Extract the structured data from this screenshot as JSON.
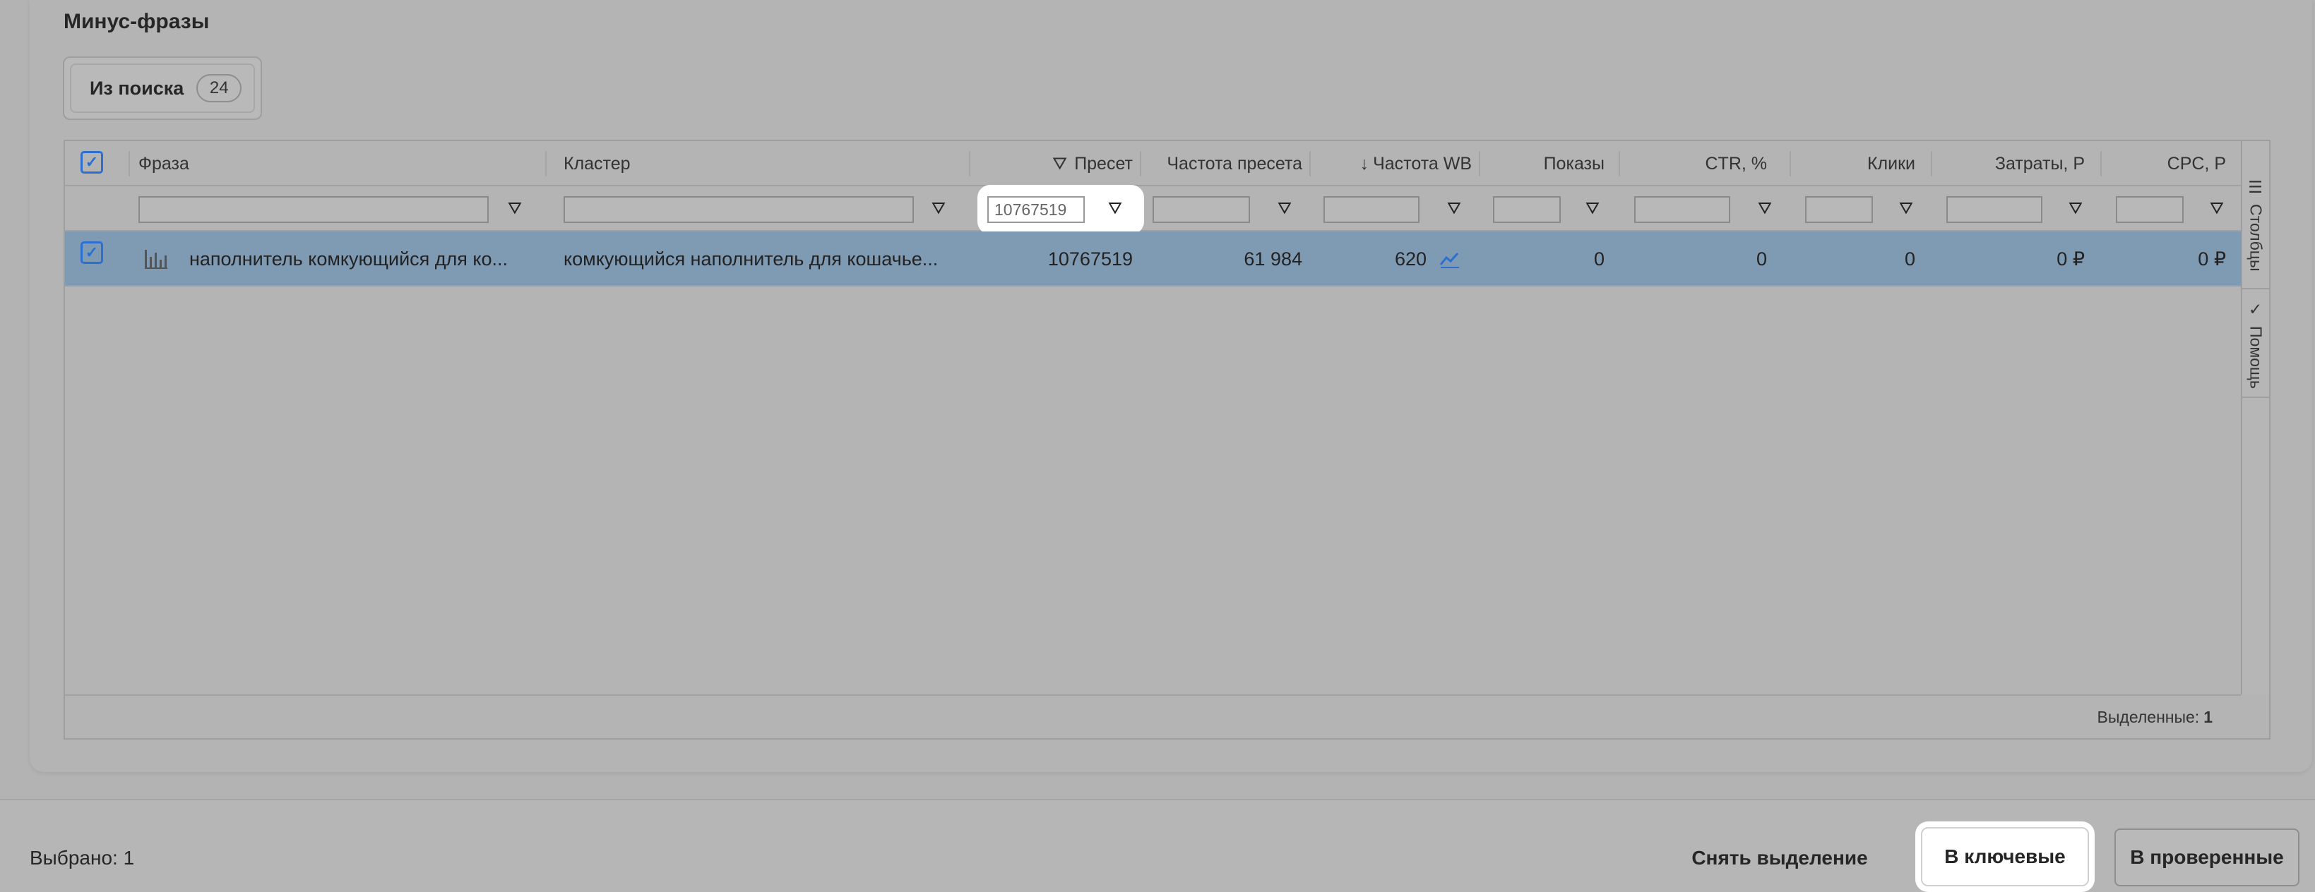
{
  "section": {
    "title": "Минус-фразы",
    "tab_label": "Из поиска",
    "tab_count": "24"
  },
  "columns": {
    "phrase": "Фраза",
    "cluster": "Кластер",
    "preset": "Пресет",
    "preset_freq": "Частота пресета",
    "wb_freq": "Частота WB",
    "shows": "Показы",
    "ctr": "CTR, %",
    "clicks": "Клики",
    "costs": "Затраты, Р",
    "cpc": "CPC, Р"
  },
  "filters": {
    "preset_value": "10767519"
  },
  "rows": [
    {
      "phrase": "наполнитель комкующийся для ко...",
      "cluster": "комкующийся наполнитель для кошачье...",
      "preset": "10767519",
      "preset_freq": "61 984",
      "wb_freq": "620",
      "shows": "0",
      "ctr": "0",
      "clicks": "0",
      "costs": "0 ₽",
      "cpc": "0 ₽"
    }
  ],
  "grid_footer": {
    "selected_label": "Выделенные:",
    "selected_count": "1"
  },
  "side_panel": {
    "columns_tab": "Столбцы",
    "help_tab": "Помощь"
  },
  "bottom_bar": {
    "selected_label": "Выбрано:",
    "selected_count": "1",
    "clear_selection": "Снять выделение",
    "to_keywords": "В ключевые",
    "to_checked": "В проверенные"
  },
  "icons": {
    "filter": "filter-icon",
    "sort_desc": "arrow-down-icon",
    "chart": "bar-chart-icon",
    "trend": "trend-line-icon"
  },
  "colors": {
    "selected_row": "#7f9ab3",
    "accent": "#2c6fd1"
  }
}
